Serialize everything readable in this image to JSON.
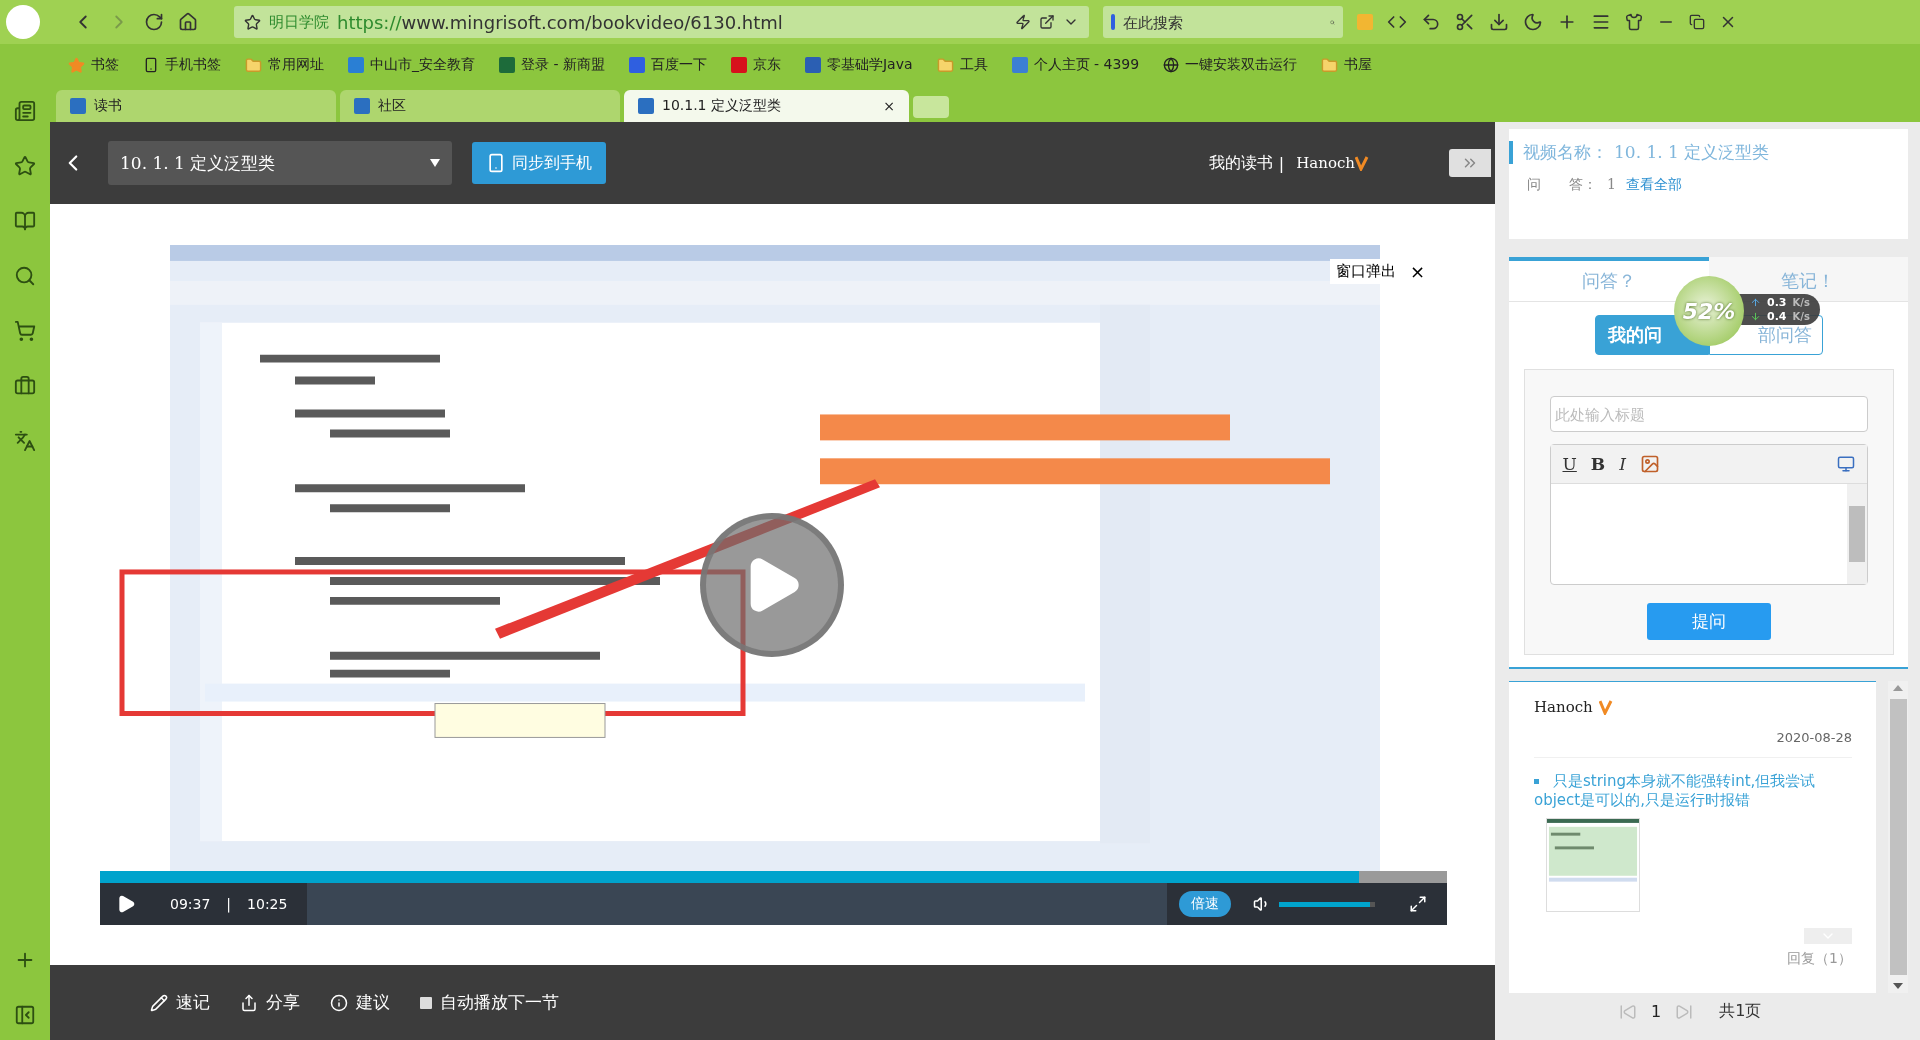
{
  "browser": {
    "site_label": "明日学院",
    "url_scheme": "https://",
    "url_rest": "www.mingrisoft.com/bookvideo/6130.html",
    "search": {
      "placeholder": "在此搜索"
    }
  },
  "bookmarks": [
    {
      "label": "书签",
      "kind": "star"
    },
    {
      "label": "手机书签",
      "kind": "phone"
    },
    {
      "label": "常用网址",
      "kind": "folder"
    },
    {
      "label": "中山市_安全教育",
      "kind": "site",
      "color": "#2a7fd4"
    },
    {
      "label": "登录 - 新商盟",
      "kind": "site",
      "color": "#1d6b3a"
    },
    {
      "label": "百度一下",
      "kind": "site",
      "color": "#2f5fe0"
    },
    {
      "label": "京东",
      "kind": "site",
      "color": "#d7111c"
    },
    {
      "label": "零基础学Java",
      "kind": "site",
      "color": "#2b5fb3"
    },
    {
      "label": "工具",
      "kind": "folder"
    },
    {
      "label": "个人主页 - 4399",
      "kind": "site",
      "color": "#3c7fd4"
    },
    {
      "label": "一键安装双击运行",
      "kind": "globe"
    },
    {
      "label": "书屋",
      "kind": "folder"
    }
  ],
  "tabs": [
    {
      "label": "读书",
      "selected": false
    },
    {
      "label": "社区",
      "selected": false
    },
    {
      "label": "10.1.1 定义泛型类",
      "selected": true,
      "close": "×"
    }
  ],
  "header": {
    "lesson_select": "10. 1. 1  定义泛型类",
    "sync_button": "同步到手机",
    "my_books": "我的读书",
    "separator": "|",
    "user": "Hanoch"
  },
  "player": {
    "popout": "窗口弹出",
    "popout_close": "×",
    "progress": {
      "level": 0.935
    },
    "current_time": "09:37",
    "separator": "|",
    "duration": "10:25",
    "speed": "倍速",
    "volume": {
      "level": 0.95
    }
  },
  "bottom_bar": [
    {
      "label": "速记",
      "kind": "note"
    },
    {
      "label": "分享",
      "kind": "share"
    },
    {
      "label": "建议",
      "kind": "info"
    },
    {
      "label": "自动播放下一节",
      "kind": "checkbox",
      "checked": false
    }
  ],
  "side_panel": {
    "video_name_label": "视频名称：",
    "video_name": "10. 1. 1  定义泛型类",
    "qa_label": "问　　答：",
    "qa_count": "1",
    "view_all": "查看全部",
    "tabs": [
      {
        "label": "问答？",
        "selected": true
      },
      {
        "label": "笔记！",
        "selected": false
      }
    ],
    "sub_tabs": [
      {
        "label": "我的问",
        "selected": true
      },
      {
        "label": "部问答",
        "selected": false
      }
    ],
    "title_placeholder": "此处输入标题",
    "editor_tools": [
      "U",
      "B",
      "I"
    ],
    "submit": "提问",
    "answers": [
      {
        "user": "Hanoch",
        "date": "2020-08-28",
        "text": "只是string本身就不能强转int,但我尝试object是可以的,只是运行时报错",
        "replies": "回复（1）"
      }
    ],
    "pager": {
      "page": "1",
      "total": "共1页"
    }
  },
  "speed_widget": {
    "percent": "52%",
    "upload": "0.3",
    "upload_unit": "K/s",
    "download": "0.4",
    "download_unit": "K/s"
  }
}
